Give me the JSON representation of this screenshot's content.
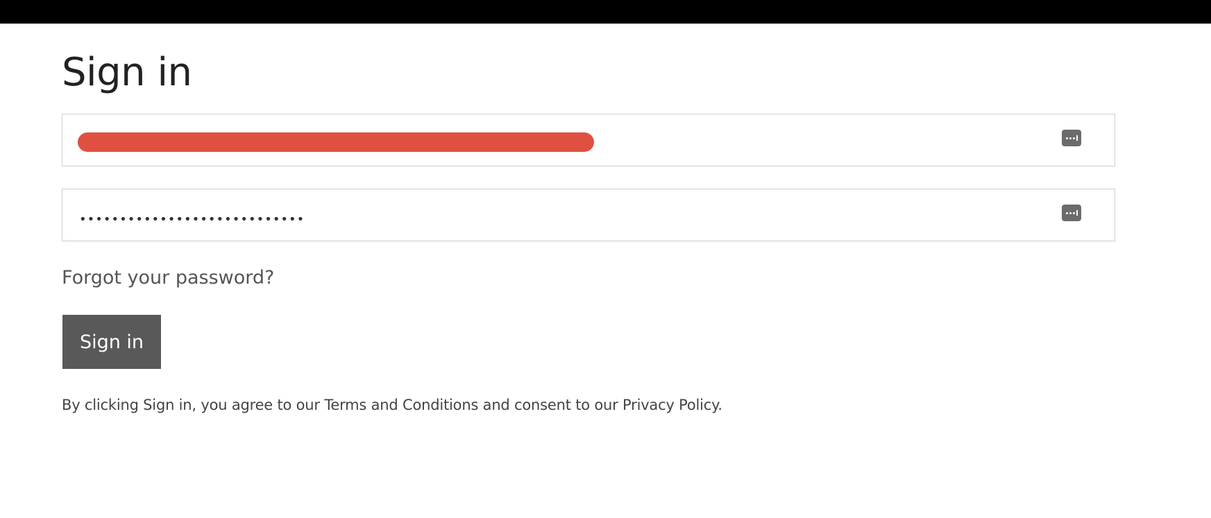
{
  "page": {
    "title": "Sign in"
  },
  "form": {
    "email": {
      "value": "",
      "redacted": true,
      "icon": "password-manager-key-icon"
    },
    "password": {
      "value": "••••••••••••••••••••••••••••",
      "icon": "password-manager-key-icon"
    },
    "forgot_password_label": "Forgot your password?",
    "submit_label": "Sign in",
    "legal_text": "By clicking Sign in, you agree to our Terms and Conditions and consent to our Privacy Policy."
  },
  "colors": {
    "top_bar": "#000000",
    "button_bg": "#595959",
    "redaction": "#e05040",
    "field_border": "#cfcfcf"
  }
}
